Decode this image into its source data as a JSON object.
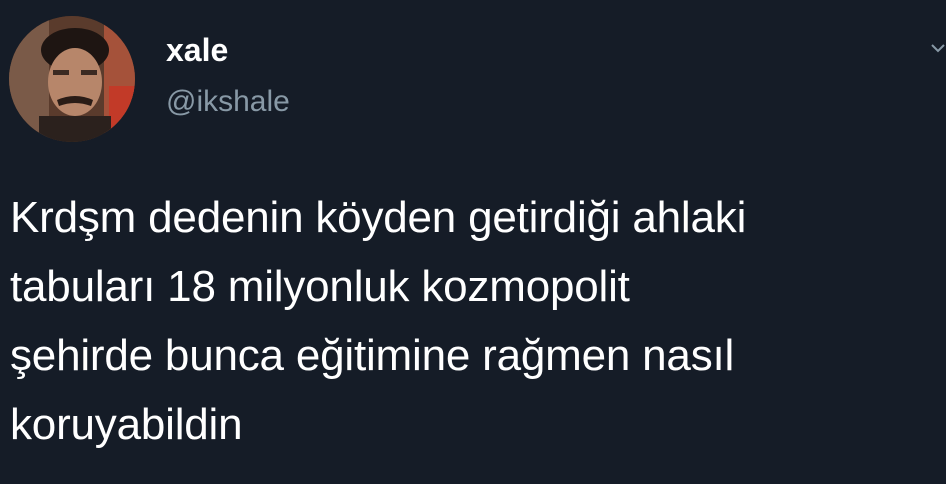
{
  "user": {
    "display_name": "xale",
    "handle": "@ikshale",
    "avatar_icon": "profile-photo"
  },
  "tweet": {
    "text": "Krdşm dedenin köyden getirdiği ahlaki\ntabuları 18 milyonluk kozmopolit\nşehirde bunca eğitimine rağmen nasıl\nkoruyabildin"
  },
  "colors": {
    "background": "#151c27",
    "text": "#ffffff",
    "handle": "#8899a6"
  }
}
